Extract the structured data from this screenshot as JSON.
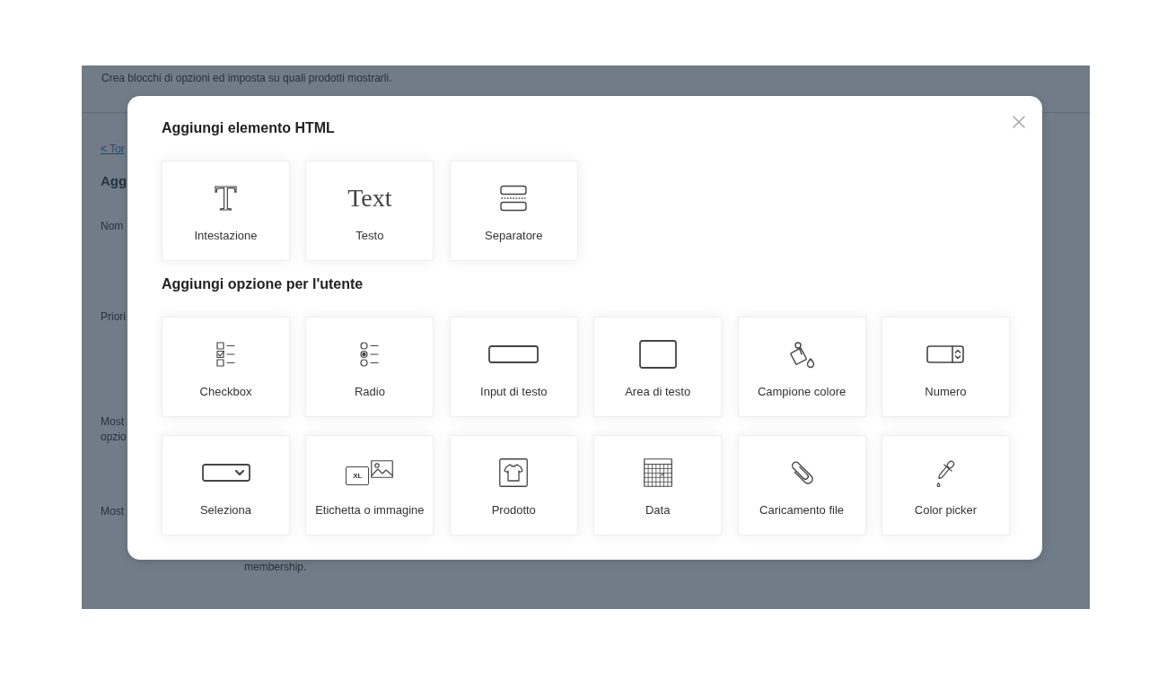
{
  "background_page": {
    "description": "Crea blocchi di opzioni ed imposta su quali prodotti mostrarli.",
    "back_link": "< Tor",
    "heading": "Agg",
    "fields": [
      {
        "label": [
          "Nom"
        ]
      },
      {
        "label": [
          "Priori"
        ]
      },
      {
        "label": [
          "Most",
          "opzio"
        ]
      },
      {
        "label": [
          "Most"
        ],
        "note": "membership."
      }
    ]
  },
  "modal": {
    "sections": [
      {
        "title": "Aggiungi elemento HTML",
        "items": [
          {
            "kind": "heading",
            "glyph": "T",
            "label": "Intestazione"
          },
          {
            "kind": "text",
            "glyph": "Text",
            "label": "Testo"
          },
          {
            "kind": "separator",
            "label": "Separatore"
          }
        ]
      },
      {
        "title": "Aggiungi opzione per l'utente",
        "items": [
          {
            "kind": "checkbox",
            "label": "Checkbox"
          },
          {
            "kind": "radio",
            "label": "Radio"
          },
          {
            "kind": "text-input",
            "label": "Input di testo"
          },
          {
            "kind": "textarea",
            "label": "Area di testo"
          },
          {
            "kind": "color-swatch",
            "label": "Campione colore"
          },
          {
            "kind": "number",
            "label": "Numero"
          },
          {
            "kind": "select",
            "label": "Seleziona"
          },
          {
            "kind": "label-image",
            "glyph": "XL",
            "label": "Etichetta o immagine"
          },
          {
            "kind": "product",
            "label": "Prodotto"
          },
          {
            "kind": "date",
            "label": "Data"
          },
          {
            "kind": "file-upload",
            "label": "Caricamento file"
          },
          {
            "kind": "color-picker",
            "label": "Color picker"
          }
        ]
      }
    ]
  }
}
